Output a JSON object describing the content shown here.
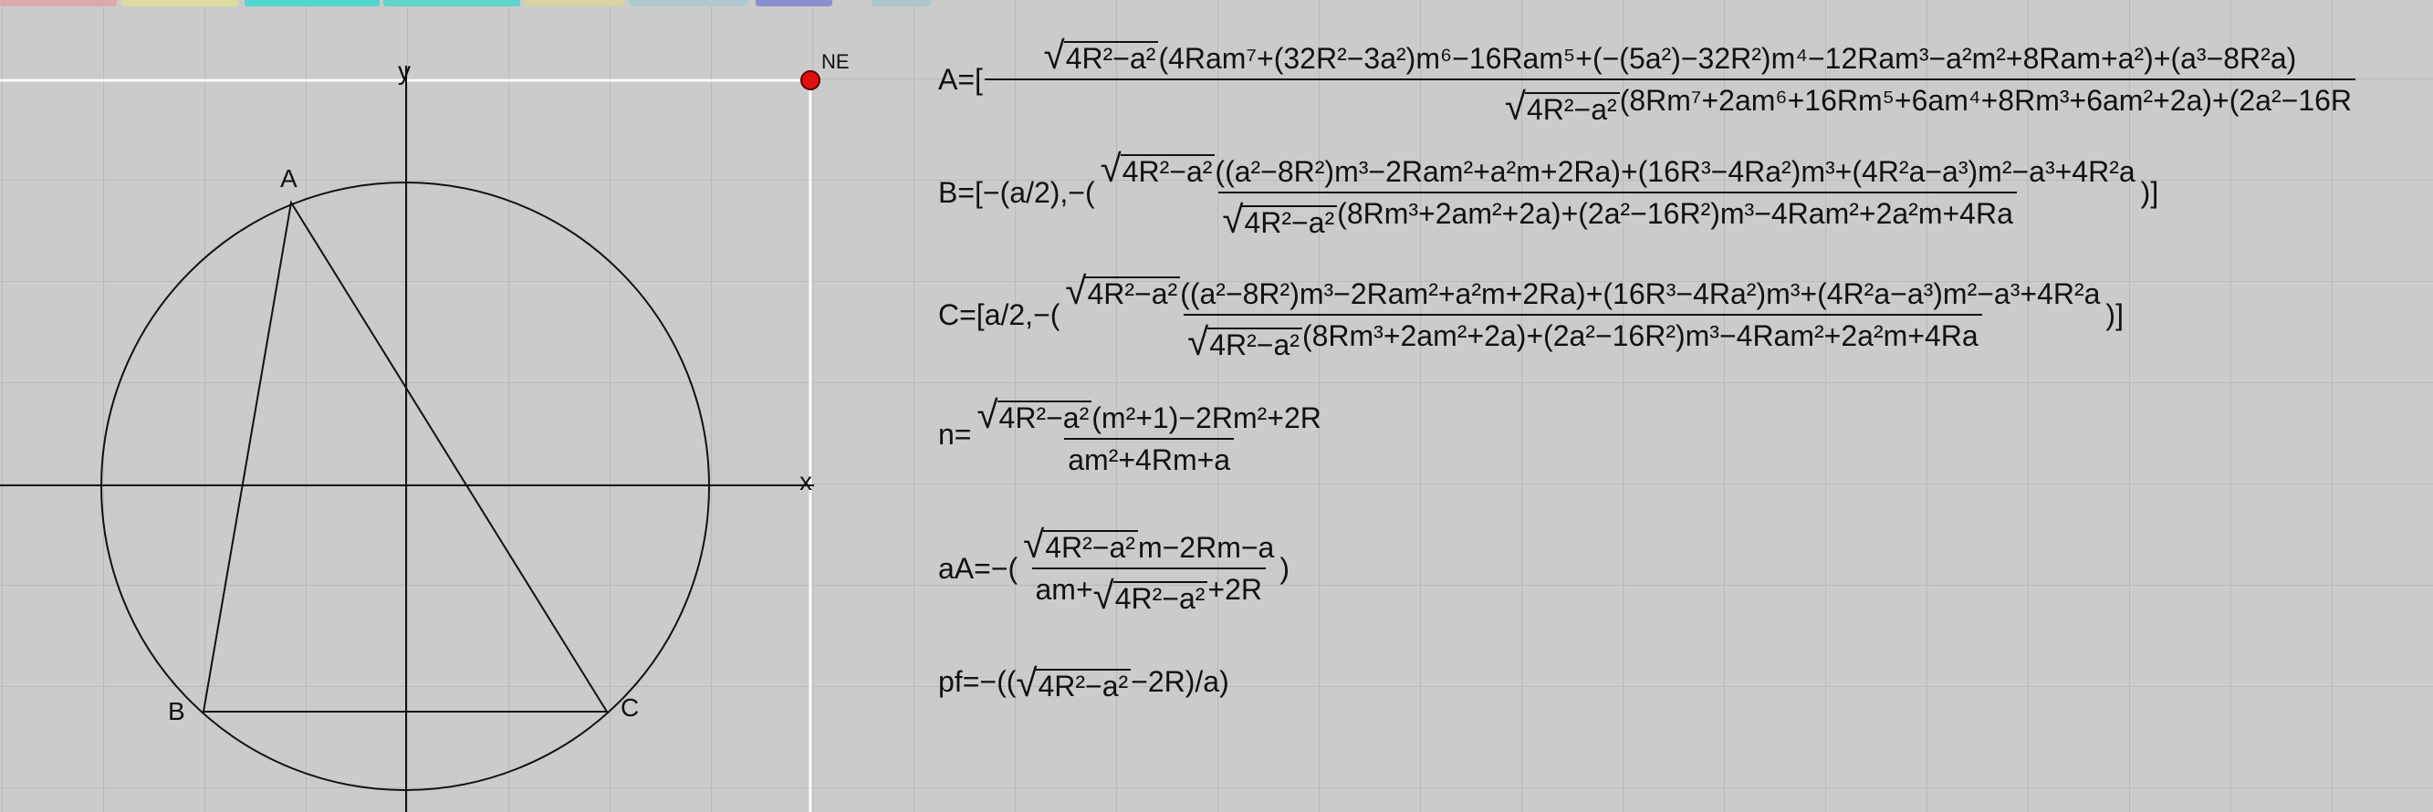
{
  "tabs": [
    {
      "color": "#d9a9ae"
    },
    {
      "color": "#dcdca0"
    },
    {
      "color": "#53d6d0"
    },
    {
      "color": "#5fd5cd"
    },
    {
      "color": "#d9d2a2"
    },
    {
      "color": "#b0c9cf"
    },
    {
      "color": "#8d8ed0"
    },
    {
      "color": "#afc6cd"
    }
  ],
  "axes": {
    "x_label": "x",
    "y_label": "y"
  },
  "points": {
    "A": "A",
    "B": "B",
    "C": "C",
    "NE": "NE"
  },
  "equations": {
    "A_lhs": "A=[",
    "A_num_pre": "4R",
    "A_num_rad_rest": "−a",
    "A_num_tail": "(4Ram⁷+(32R²−3a²)m⁶−16Ram⁵+(−(5a²)−32R²)m⁴−12Ram³−a²m²+8Ram+a²)+(a³−8R²a)",
    "A_den_tail": "(8Rm⁷+2am⁶+16Rm⁵+6am⁴+8Rm³+6am²+2a)+(2a²−16R",
    "B_lhs": "B=[−(a/2),−(",
    "B_num_tail": "((a²−8R²)m³−2Ram²+a²m+2Ra)+(16R³−4Ra²)m³+(4R²a−a³)m²−a³+4R²a",
    "B_den_tail": "(8Rm³+2am²+2a)+(2a²−16R²)m³−4Ram²+2a²m+4Ra",
    "B_close": ")]",
    "C_lhs": "C=[a/2,−(",
    "C_num_tail": "((a²−8R²)m³−2Ram²+a²m+2Ra)+(16R³−4Ra²)m³+(4R²a−a³)m²−a³+4R²a",
    "C_den_tail": "(8Rm³+2am²+2a)+(2a²−16R²)m³−4Ram²+2a²m+4Ra",
    "C_close": ")]",
    "n_lhs": "n=",
    "n_num_tail": "(m²+1)−2Rm²+2R",
    "n_den": "am²+4Rm+a",
    "aA_lhs": "aA=−(",
    "aA_num_tail": "m−2Rm−a",
    "aA_den_pre": "am+",
    "aA_den_tail": "+2R",
    "aA_close": ")",
    "pf_lhs": "pf=−((",
    "pf_tail": "−2R)/a)",
    "rad_body": "4R²−a²"
  }
}
